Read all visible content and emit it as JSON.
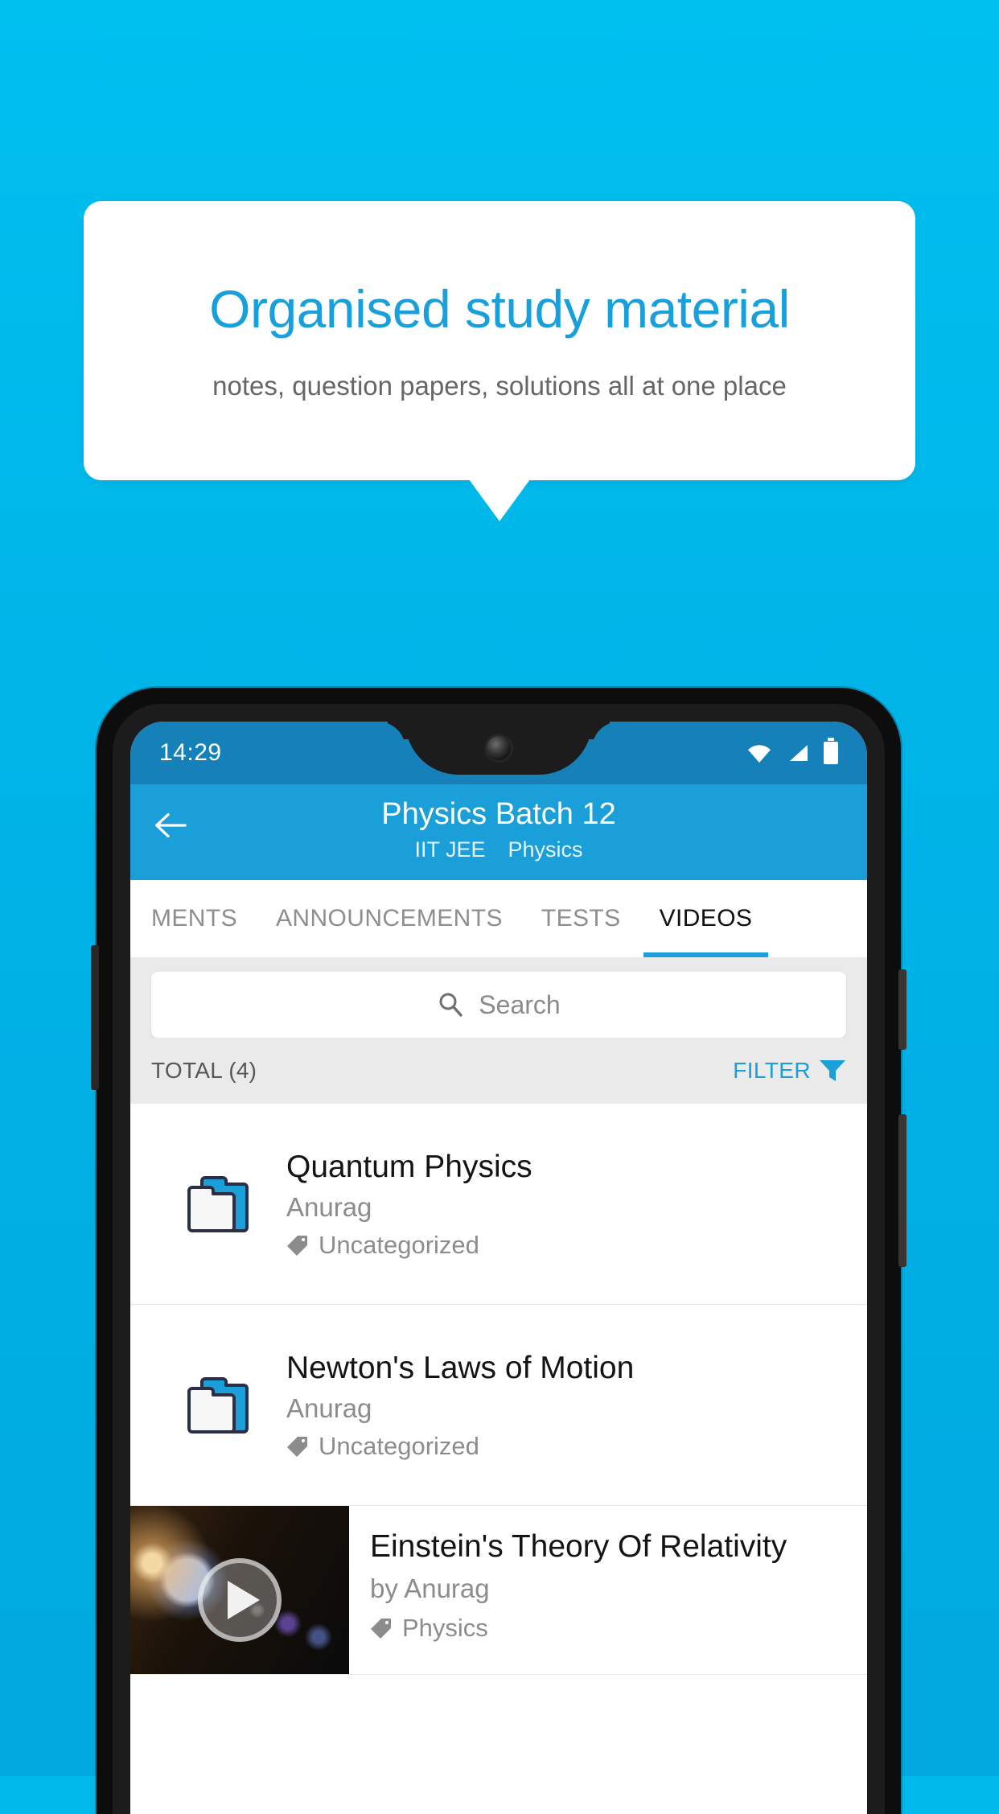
{
  "promo": {
    "title": "Organised study material",
    "subtitle": "notes, question papers, solutions all at one place",
    "accent_color": "#18a0dc",
    "background_color": "#00b4e8"
  },
  "phone": {
    "statusbar": {
      "time": "14:29",
      "icons": [
        "wifi-icon",
        "signal-icon",
        "battery-icon"
      ]
    },
    "appbar": {
      "back_icon": "back-arrow-icon",
      "title": "Physics Batch 12",
      "subtitle_exam": "IIT JEE",
      "subtitle_subject": "Physics",
      "color": "#1a9fd9"
    },
    "tabs": [
      {
        "label": "MENTS",
        "active": false
      },
      {
        "label": "ANNOUNCEMENTS",
        "active": false
      },
      {
        "label": "TESTS",
        "active": false
      },
      {
        "label": "VIDEOS",
        "active": true
      }
    ],
    "search": {
      "placeholder": "Search",
      "value": "",
      "icon": "search-icon"
    },
    "toolbar": {
      "total_label": "TOTAL (4)",
      "filter_label": "FILTER",
      "filter_icon": "filter-funnel-icon",
      "filter_color": "#1a9fd9"
    },
    "items": [
      {
        "type": "folder",
        "icon": "folder-icon",
        "title": "Quantum Physics",
        "author": "Anurag",
        "tag": "Uncategorized"
      },
      {
        "type": "folder",
        "icon": "folder-icon",
        "title": "Newton's Laws of Motion",
        "author": "Anurag",
        "tag": "Uncategorized"
      },
      {
        "type": "video",
        "icon": "play-icon",
        "title": "Einstein's Theory Of Relativity",
        "author": "by Anurag",
        "tag": "Physics"
      }
    ]
  }
}
